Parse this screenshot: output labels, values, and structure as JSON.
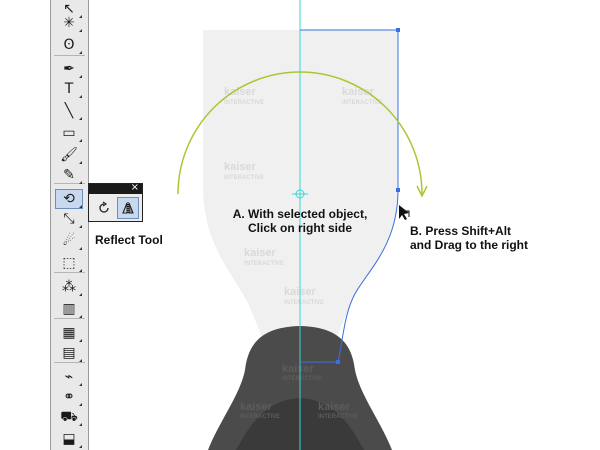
{
  "tools_panel": {
    "items": [
      {
        "name": "direct-selection-icon",
        "glyph": "↖"
      },
      {
        "name": "magic-wand-icon",
        "glyph": "✳"
      },
      {
        "name": "lasso-icon",
        "glyph": "ʘ"
      },
      {
        "name": "pen-icon",
        "glyph": "✒"
      },
      {
        "name": "type-icon",
        "glyph": "T"
      },
      {
        "name": "line-segment-icon",
        "glyph": "╲"
      },
      {
        "name": "rectangle-icon",
        "glyph": "▭"
      },
      {
        "name": "paintbrush-icon",
        "glyph": "🖌"
      },
      {
        "name": "pencil-icon",
        "glyph": "✎"
      },
      {
        "name": "reflect-icon",
        "glyph": "⟲"
      },
      {
        "name": "scale-icon",
        "glyph": "⤡"
      },
      {
        "name": "warp-icon",
        "glyph": "☄"
      },
      {
        "name": "free-transform-icon",
        "glyph": "⬚"
      },
      {
        "name": "symbol-sprayer-icon",
        "glyph": "⁂"
      },
      {
        "name": "column-graph-icon",
        "glyph": "▥"
      },
      {
        "name": "mesh-icon",
        "glyph": "▦"
      },
      {
        "name": "gradient-icon",
        "glyph": "▤"
      },
      {
        "name": "eyedropper-icon",
        "glyph": "⌁"
      },
      {
        "name": "blend-icon",
        "glyph": "⚭"
      },
      {
        "name": "live-paint-bucket-icon",
        "glyph": "⛟"
      },
      {
        "name": "live-paint-selection-icon",
        "glyph": "⬓"
      }
    ],
    "active_tool": "reflect-icon"
  },
  "flyout": {
    "close_glyph": "×",
    "buttons": [
      "rotate-icon",
      "reflect-icon"
    ]
  },
  "labels": {
    "reflect_tool": "Reflect Tool",
    "step_a_line1": "A. With selected object,",
    "step_a_line2": "Click on right side",
    "step_b_line1": "B. Press Shift+Alt",
    "step_b_line2": "and Drag to the right"
  },
  "watermark": {
    "brand": "kaiser",
    "sub": "INTERACTIVE"
  },
  "colors": {
    "guide": "#3cd6d6",
    "path": "#3b6fe0",
    "arc": "#a8c832",
    "bottle_light": "#f0f0f0",
    "bottle_dark": "#4a4a4a",
    "bottle_darker": "#363636"
  }
}
